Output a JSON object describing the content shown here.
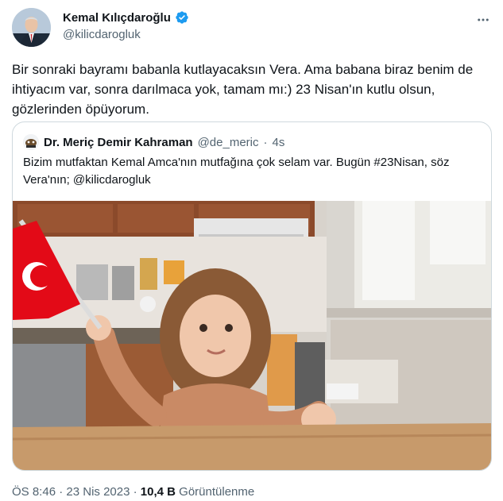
{
  "author": {
    "name": "Kemal Kılıçdaroğlu",
    "handle": "@kilicdarogluk",
    "verified": true,
    "avatar_icon": "profile-photo"
  },
  "tweet": {
    "text": "Bir sonraki bayramı babanla kutlayacaksın Vera. Ama babana biraz benim de ihtiyacım var, sonra darılmaca yok, tamam mı:) 23 Nisan'ın kutlu olsun, gözlerinden öpüyorum."
  },
  "quoted": {
    "name": "Dr. Meriç Demir Kahraman",
    "handle": "@de_meric",
    "dot": "·",
    "time": "4s",
    "text": "Bizim mutfaktan Kemal Amca'nın mutfağına çok selam var. Bugün #23Nisan, söz Vera'nın; @kilicdarogluk",
    "media_icon": "video-thumbnail"
  },
  "meta": {
    "time": "ÖS 8:46",
    "sep1": "·",
    "date": "23 Nis 2023",
    "sep2": "·",
    "views_count": "10,4 B",
    "views_label": "Görüntülenme"
  },
  "colors": {
    "verified": "#1d9bf0",
    "secondary_text": "#536471",
    "border": "#cfd9de",
    "flag_red": "#e30a17"
  }
}
